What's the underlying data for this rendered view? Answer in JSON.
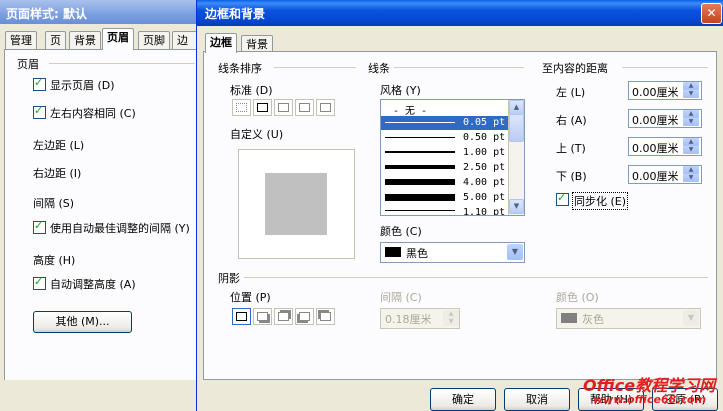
{
  "bg_dialog": {
    "title": "页面样式: 默认",
    "tabs": [
      "管理",
      "页",
      "背景",
      "页眉",
      "页脚",
      "边框"
    ],
    "active_tab": "页眉",
    "section_header": "页眉",
    "show_header": "显示页眉 (D)",
    "same_content": "左右内容相同 (C)",
    "left_margin": "左边距 (L)",
    "right_margin": "右边距 (I)",
    "spacing": "间隔 (S)",
    "auto_spacing": "使用自动最佳调整的间隔 (Y)",
    "height": "高度 (H)",
    "auto_height": "自动调整高度 (A)",
    "more_button": "其他 (M)..."
  },
  "dialog": {
    "title": "边框和背景",
    "close": "✕",
    "tabs": [
      "边框",
      "背景"
    ],
    "active_tab": "边框",
    "line_arrangement": {
      "group": "线条排序",
      "standard": "标准 (D)",
      "custom": "自定义 (U)"
    },
    "line": {
      "group": "线条",
      "style_label": "风格 (Y)",
      "styles": [
        "- 无 -",
        "0.05 pt",
        "0.50 pt",
        "1.00 pt",
        "2.50 pt",
        "4.00 pt",
        "5.00 pt",
        "1.10 pt"
      ],
      "selected_index": 1,
      "color_label": "颜色 (C)",
      "color_value": "黑色",
      "color_swatch": "#000000"
    },
    "distance": {
      "group": "至内容的距离",
      "left_label": "左 (L)",
      "left_value": "0.00厘米",
      "right_label": "右 (A)",
      "right_value": "0.00厘米",
      "top_label": "上 (T)",
      "top_value": "0.00厘米",
      "bottom_label": "下 (B)",
      "bottom_value": "0.00厘米",
      "sync_label": "同步化 (E)"
    },
    "shadow": {
      "group": "阴影",
      "position_label": "位置 (P)",
      "spacing_label": "间隔 (C)",
      "spacing_value": "0.18厘米",
      "color_label": "颜色 (O)",
      "color_value": "灰色",
      "color_swatch": "#808080"
    },
    "buttons": {
      "ok": "确定",
      "cancel": "取消",
      "help": "帮助 (H)",
      "reset": "还原 (R)"
    }
  },
  "watermark": {
    "line1": "Office教程学习网",
    "line2": "www.office68.com"
  }
}
